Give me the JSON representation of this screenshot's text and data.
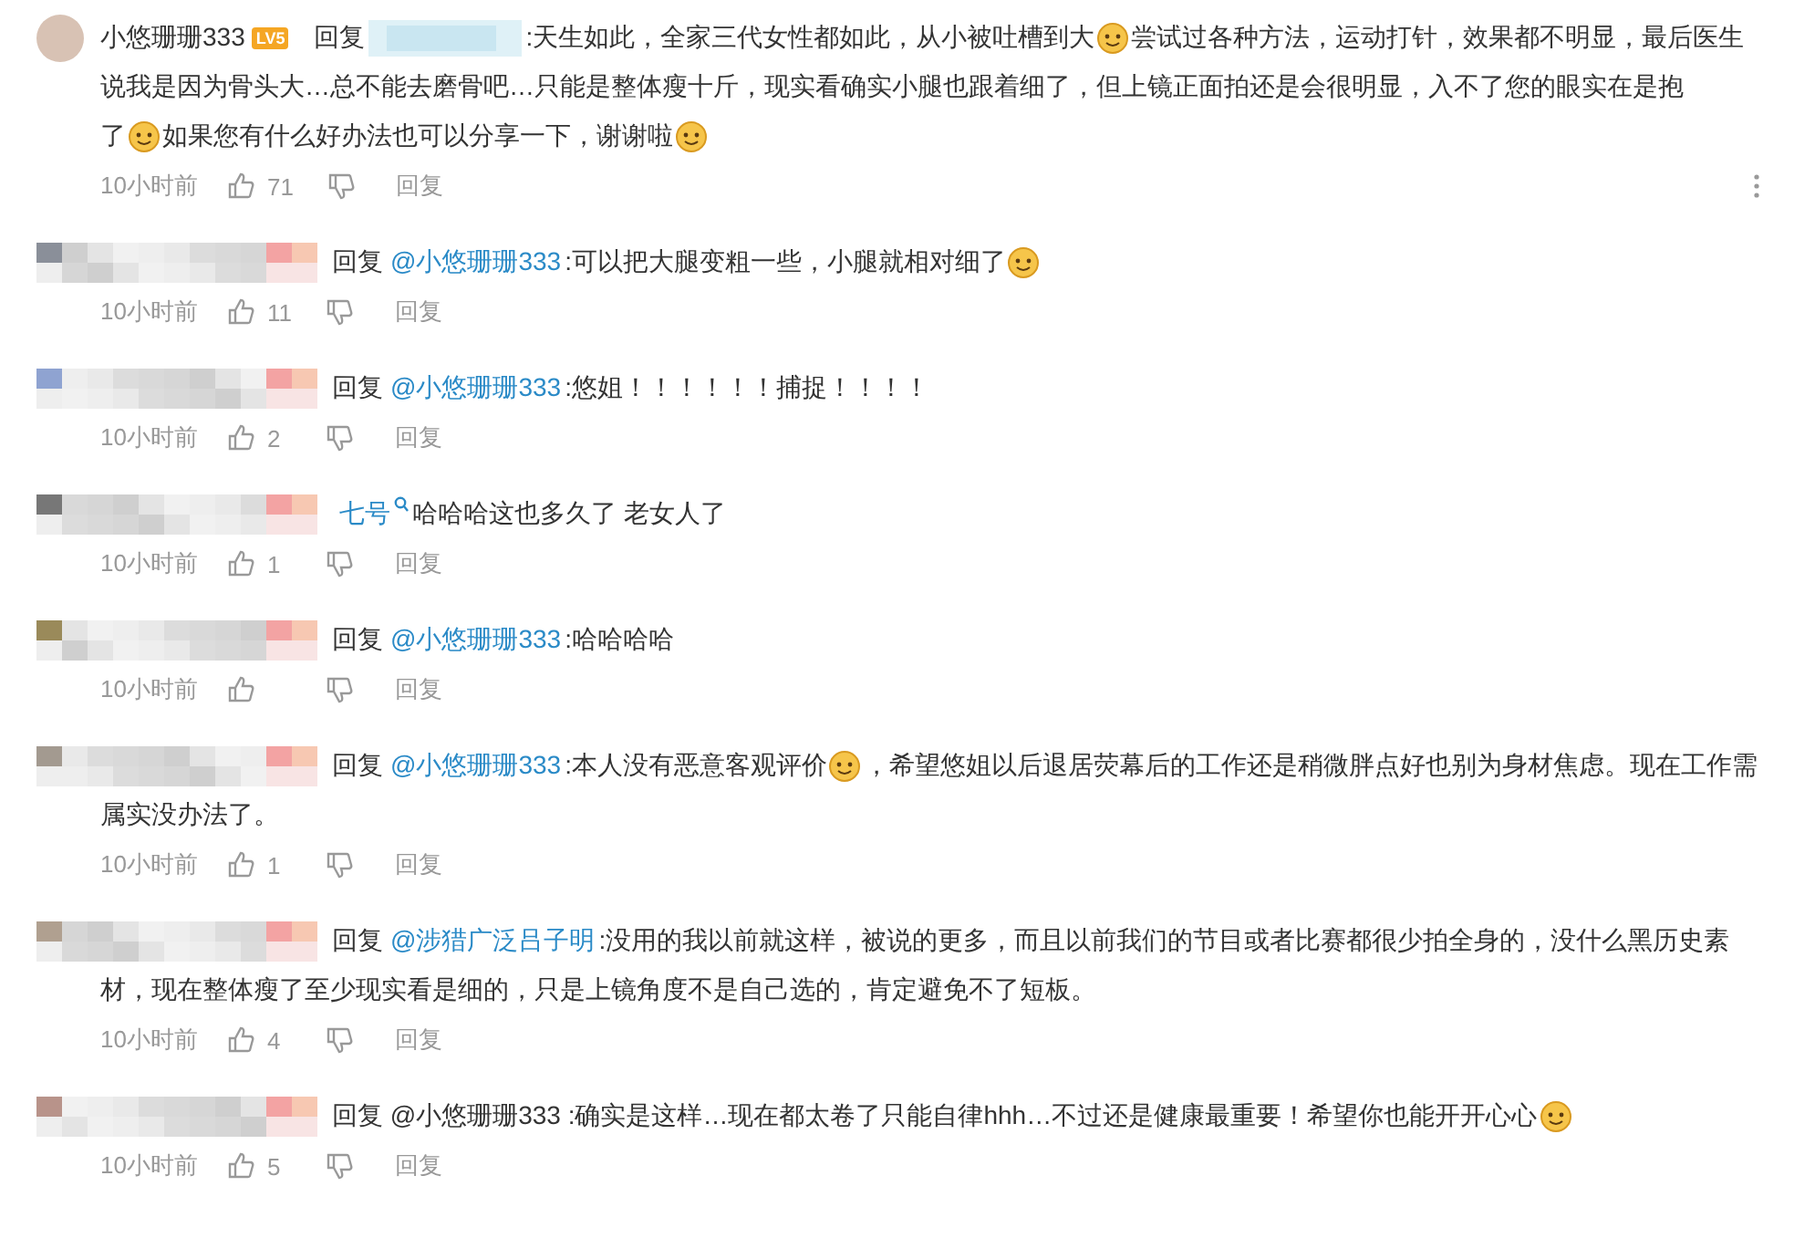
{
  "comments": [
    {
      "author": {
        "kind": "named",
        "name": "小悠珊珊333",
        "badge": "LV5"
      },
      "lines": [
        [
          {
            "kind": "text",
            "text": "回复"
          },
          {
            "kind": "blur"
          },
          {
            "kind": "text",
            "text": ":天生如此，全家三代女性都如此，从小被吐槽到大"
          },
          {
            "kind": "emoji"
          },
          {
            "kind": "text",
            "text": "尝试过各种方法，运动打针，效果都不明显，最后医生"
          }
        ],
        [
          {
            "kind": "text",
            "text": "说我是因为骨头大…总不能去磨骨吧…只能是整体瘦十斤，现实看确实小腿也跟着细了，但上镜正面拍还是会很明显，入不了您的眼实在是抱"
          }
        ],
        [
          {
            "kind": "text",
            "text": "了"
          },
          {
            "kind": "emoji"
          },
          {
            "kind": "text",
            "text": "如果您有什么好办法也可以分享一下，谢谢啦"
          },
          {
            "kind": "emoji"
          }
        ]
      ],
      "time": "10小时前",
      "likes": "71",
      "reply": "回复",
      "has_menu": true
    },
    {
      "author": {
        "kind": "blurred"
      },
      "lines": [
        [
          {
            "kind": "text",
            "text": "回复"
          },
          {
            "kind": "mention",
            "text": "@小悠珊珊333"
          },
          {
            "kind": "text",
            "text": ":可以把大腿变粗一些，小腿就相对细了"
          },
          {
            "kind": "emoji"
          }
        ]
      ],
      "time": "10小时前",
      "likes": "11",
      "reply": "回复",
      "has_menu": false
    },
    {
      "author": {
        "kind": "blurred"
      },
      "lines": [
        [
          {
            "kind": "text",
            "text": "回复"
          },
          {
            "kind": "mention",
            "text": "@小悠珊珊333"
          },
          {
            "kind": "text",
            "text": ":悠姐！！！！！！捕捉！！！！"
          }
        ]
      ],
      "time": "10小时前",
      "likes": "2",
      "reply": "回复",
      "has_menu": false
    },
    {
      "author": {
        "kind": "blurred"
      },
      "lines": [
        [
          {
            "kind": "mention",
            "text": "七号"
          },
          {
            "kind": "ring"
          },
          {
            "kind": "text",
            "text": "哈哈哈这也多久了 老女人了"
          }
        ]
      ],
      "time": "10小时前",
      "likes": "1",
      "reply": "回复",
      "has_menu": false
    },
    {
      "author": {
        "kind": "blurred"
      },
      "lines": [
        [
          {
            "kind": "text",
            "text": "回复"
          },
          {
            "kind": "mention",
            "text": "@小悠珊珊333"
          },
          {
            "kind": "text",
            "text": ":哈哈哈哈"
          }
        ]
      ],
      "time": "10小时前",
      "reply": "回复",
      "has_menu": false
    },
    {
      "author": {
        "kind": "blurred"
      },
      "lines": [
        [
          {
            "kind": "text",
            "text": "回复"
          },
          {
            "kind": "mention",
            "text": "@小悠珊珊333"
          },
          {
            "kind": "text",
            "text": ":本人没有恶意客观评价"
          },
          {
            "kind": "emoji"
          },
          {
            "kind": "text",
            "text": "，希望悠姐以后退居荧幕后的工作还是稍微胖点好也别为身材焦虑。现在工作需"
          }
        ],
        [
          {
            "kind": "text",
            "text": "属实没办法了。"
          }
        ]
      ],
      "time": "10小时前",
      "likes": "1",
      "reply": "回复",
      "has_menu": false
    },
    {
      "author": {
        "kind": "blurred"
      },
      "lines": [
        [
          {
            "kind": "text",
            "text": "回复"
          },
          {
            "kind": "mention",
            "text": "@涉猎广泛吕子明"
          },
          {
            "kind": "text",
            "text": ":没用的我以前就这样，被说的更多，而且以前我们的节目或者比赛都很少拍全身的，没什么黑历史素"
          }
        ],
        [
          {
            "kind": "text",
            "text": "材，现在整体瘦了至少现实看是细的，只是上镜角度不是自己选的，肯定避免不了短板。"
          }
        ]
      ],
      "time": "10小时前",
      "likes": "4",
      "reply": "回复",
      "has_menu": false
    },
    {
      "author": {
        "kind": "blurred"
      },
      "lines": [
        [
          {
            "kind": "text",
            "text": "回复 @小悠珊珊333 :确实是这样…现在都太卷了只能自律hhh…不过还是健康最重要！希望你也能开开心心"
          },
          {
            "kind": "emoji"
          }
        ]
      ],
      "time": "10小时前",
      "likes": "5",
      "reply": "回复",
      "has_menu": false
    }
  ]
}
